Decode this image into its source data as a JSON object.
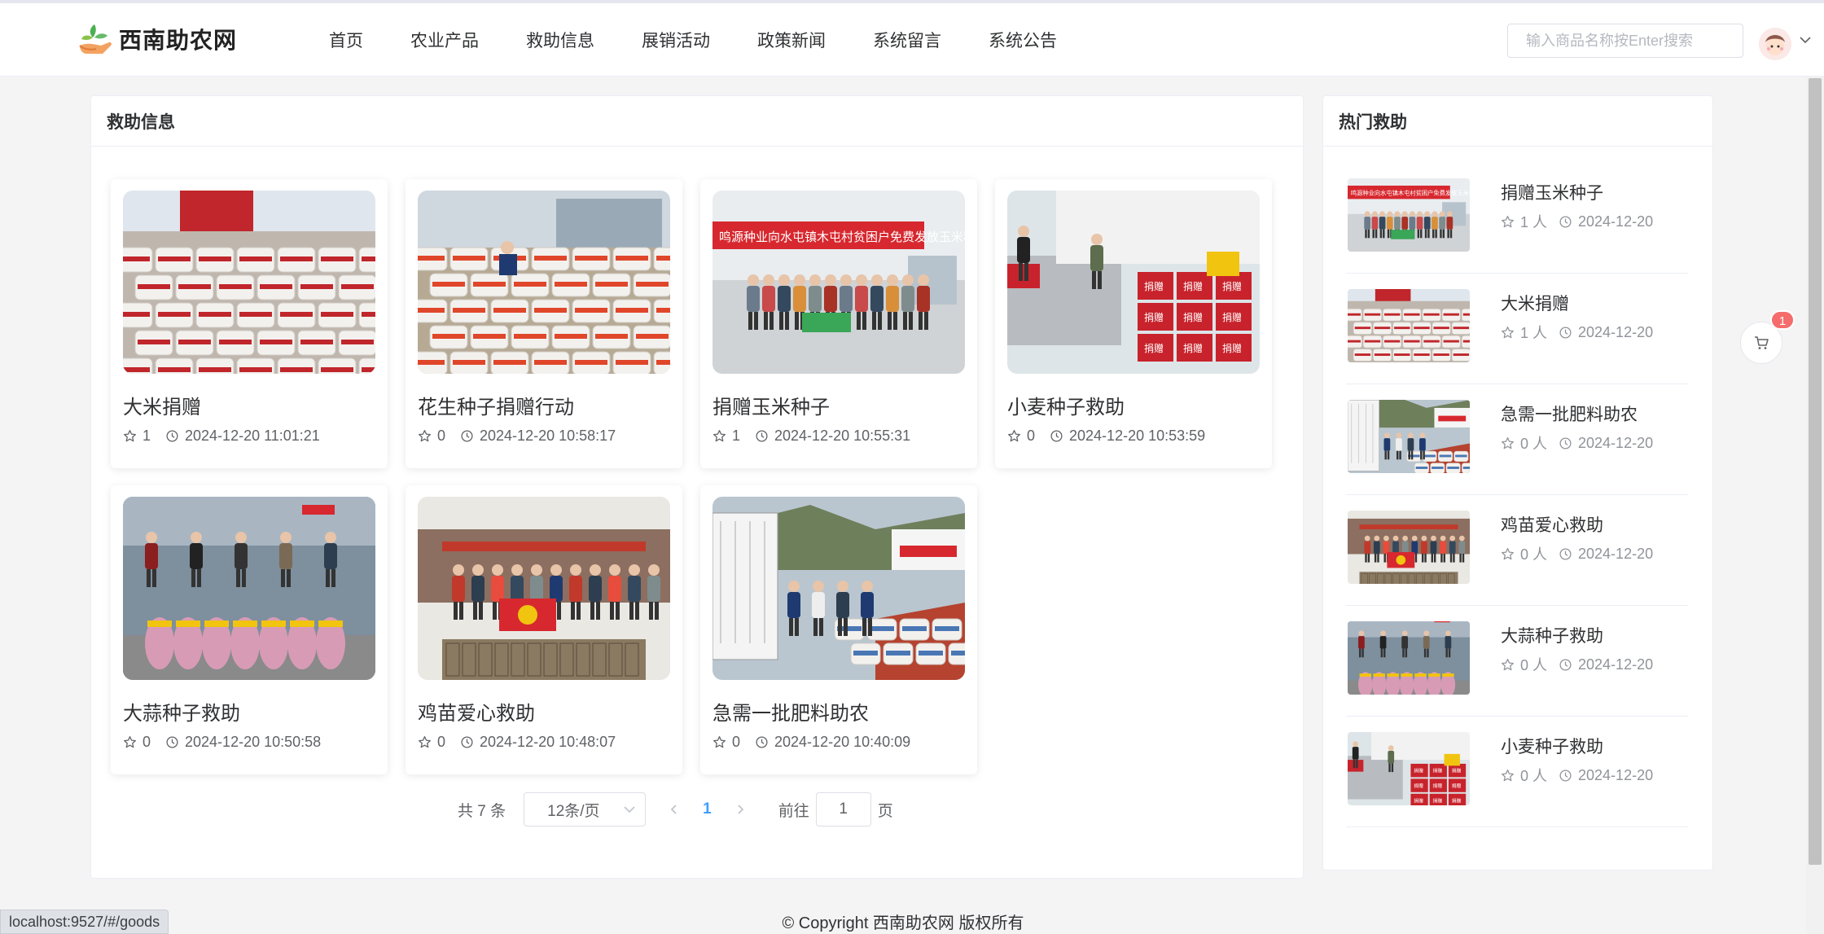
{
  "header": {
    "site_name": "西南助农网",
    "nav": [
      "首页",
      "农业产品",
      "救助信息",
      "展销活动",
      "政策新闻",
      "系统留言",
      "系统公告"
    ],
    "search_placeholder": "输入商品名称按Enter搜索"
  },
  "main": {
    "title": "救助信息",
    "cards": [
      {
        "title": "大米捐赠",
        "likes": "1",
        "time": "2024-12-20 11:01:21",
        "image": "rice-bags-truck"
      },
      {
        "title": "花生种子捐赠行动",
        "likes": "0",
        "time": "2024-12-20 10:58:17",
        "image": "peanut-seed-bags"
      },
      {
        "title": "捐赠玉米种子",
        "likes": "1",
        "time": "2024-12-20 10:55:31",
        "image": "group-banner-photo"
      },
      {
        "title": "小麦种子救助",
        "likes": "0",
        "time": "2024-12-20 10:53:59",
        "image": "boxes-truck-unloading"
      },
      {
        "title": "大蒜种子救助",
        "likes": "0",
        "time": "2024-12-20 10:50:58",
        "image": "garlic-sacks-group"
      },
      {
        "title": "鸡苗爱心救助",
        "likes": "0",
        "time": "2024-12-20 10:48:07",
        "image": "chick-crates-group"
      },
      {
        "title": "急需一批肥料助农",
        "likes": "0",
        "time": "2024-12-20 10:40:09",
        "image": "fertilizer-truck"
      }
    ],
    "pagination": {
      "total_text": "共 7 条",
      "page_size": "12条/页",
      "current": "1",
      "goto_prefix": "前往",
      "goto_value": "1",
      "goto_suffix": "页"
    }
  },
  "side": {
    "title": "热门救助",
    "items": [
      {
        "title": "捐赠玉米种子",
        "count": "1 人",
        "date": "2024-12-20",
        "image": "group-banner-photo"
      },
      {
        "title": "大米捐赠",
        "count": "1 人",
        "date": "2024-12-20",
        "image": "rice-bags-truck"
      },
      {
        "title": "急需一批肥料助农",
        "count": "0 人",
        "date": "2024-12-20",
        "image": "fertilizer-truck"
      },
      {
        "title": "鸡苗爱心救助",
        "count": "0 人",
        "date": "2024-12-20",
        "image": "chick-crates-group"
      },
      {
        "title": "大蒜种子救助",
        "count": "0 人",
        "date": "2024-12-20",
        "image": "garlic-sacks-group"
      },
      {
        "title": "小麦种子救助",
        "count": "0 人",
        "date": "2024-12-20",
        "image": "boxes-truck-unloading"
      }
    ]
  },
  "cart": {
    "badge": "1"
  },
  "footer": {
    "copyright": "© Copyright 西南助农网 版权所有"
  },
  "status_bar": {
    "url": "localhost:9527/#/goods"
  },
  "colors": {
    "accent": "#409eff",
    "badge": "#f56c6c",
    "banner_red": "#d7282f"
  }
}
